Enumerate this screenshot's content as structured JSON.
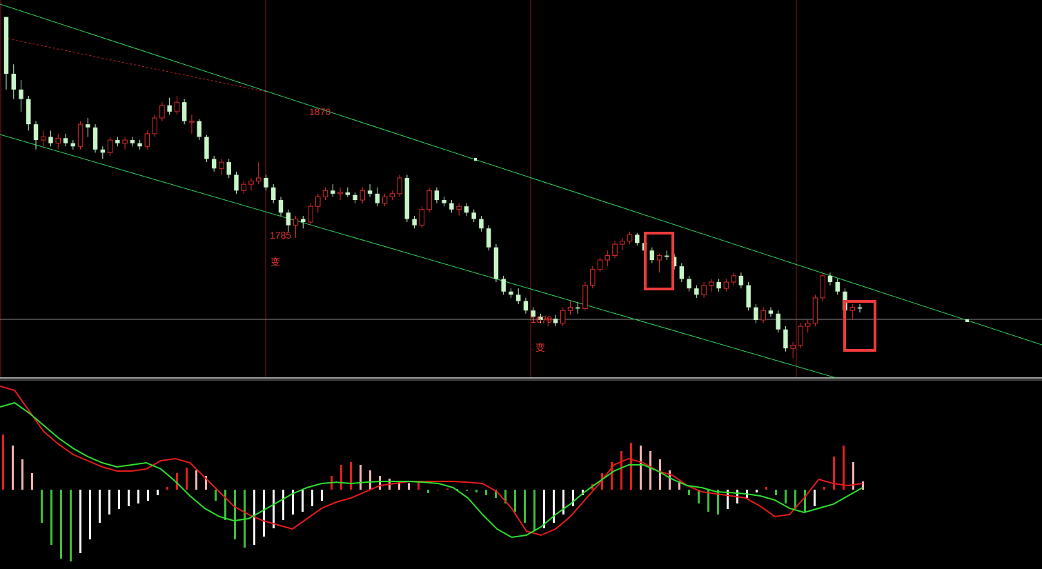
{
  "chart_data": [
    {
      "type": "candlestick",
      "title": "",
      "colors": {
        "up": "#e02b2b",
        "down": "#c8f5c8",
        "channel": "#33d65f",
        "dashed_trend": "#c62424",
        "vline": "#8a1c1c",
        "hline": "#8a8a8a",
        "highlight_box": "#ef3b3b"
      },
      "annotations": [
        {
          "label": "1870"
        },
        {
          "label": "1785"
        },
        {
          "label": "变"
        },
        {
          "label": "1679"
        },
        {
          "label": "变"
        }
      ],
      "candles_ohlc": [
        [
          1740,
          1740,
          1625,
          1650
        ],
        [
          1650,
          1665,
          1610,
          1625
        ],
        [
          1625,
          1640,
          1590,
          1610
        ],
        [
          1610,
          1615,
          1560,
          1570
        ],
        [
          1570,
          1575,
          1530,
          1545
        ],
        [
          1545,
          1560,
          1535,
          1550
        ],
        [
          1550,
          1560,
          1535,
          1540
        ],
        [
          1540,
          1555,
          1530,
          1548
        ],
        [
          1548,
          1555,
          1535,
          1540
        ],
        [
          1540,
          1545,
          1530,
          1535
        ],
        [
          1535,
          1575,
          1530,
          1570
        ],
        [
          1570,
          1580,
          1550,
          1565
        ],
        [
          1565,
          1570,
          1525,
          1530
        ],
        [
          1530,
          1535,
          1515,
          1525
        ],
        [
          1525,
          1550,
          1520,
          1545
        ],
        [
          1545,
          1550,
          1535,
          1540
        ],
        [
          1540,
          1550,
          1530,
          1545
        ],
        [
          1545,
          1550,
          1535,
          1540
        ],
        [
          1540,
          1545,
          1530,
          1535
        ],
        [
          1535,
          1560,
          1530,
          1555
        ],
        [
          1555,
          1585,
          1550,
          1580
        ],
        [
          1580,
          1605,
          1575,
          1600
        ],
        [
          1600,
          1612,
          1585,
          1590
        ],
        [
          1590,
          1615,
          1585,
          1605
        ],
        [
          1605,
          1610,
          1570,
          1575
        ],
        [
          1575,
          1585,
          1555,
          1575
        ],
        [
          1575,
          1578,
          1545,
          1550
        ],
        [
          1550,
          1553,
          1510,
          1515
        ],
        [
          1515,
          1520,
          1495,
          1500
        ],
        [
          1500,
          1515,
          1490,
          1510
        ],
        [
          1510,
          1515,
          1485,
          1490
        ],
        [
          1490,
          1495,
          1460,
          1465
        ],
        [
          1465,
          1480,
          1460,
          1475
        ],
        [
          1475,
          1485,
          1465,
          1480
        ],
        [
          1480,
          1510,
          1475,
          1485
        ],
        [
          1485,
          1490,
          1465,
          1470
        ],
        [
          1470,
          1475,
          1445,
          1450
        ],
        [
          1450,
          1455,
          1425,
          1430
        ],
        [
          1430,
          1435,
          1400,
          1410
        ],
        [
          1410,
          1425,
          1390,
          1420
        ],
        [
          1420,
          1425,
          1405,
          1415
        ],
        [
          1415,
          1445,
          1410,
          1440
        ],
        [
          1440,
          1460,
          1430,
          1455
        ],
        [
          1455,
          1470,
          1450,
          1465
        ],
        [
          1465,
          1475,
          1455,
          1460
        ],
        [
          1460,
          1470,
          1450,
          1462
        ],
        [
          1462,
          1470,
          1455,
          1458
        ],
        [
          1458,
          1462,
          1445,
          1450
        ],
        [
          1450,
          1470,
          1445,
          1465
        ],
        [
          1465,
          1475,
          1455,
          1460
        ],
        [
          1460,
          1470,
          1440,
          1445
        ],
        [
          1445,
          1460,
          1440,
          1455
        ],
        [
          1455,
          1465,
          1450,
          1460
        ],
        [
          1460,
          1490,
          1455,
          1485
        ],
        [
          1485,
          1490,
          1415,
          1420
        ],
        [
          1420,
          1425,
          1405,
          1410
        ],
        [
          1410,
          1440,
          1405,
          1435
        ],
        [
          1435,
          1470,
          1430,
          1465
        ],
        [
          1465,
          1470,
          1445,
          1450
        ],
        [
          1450,
          1455,
          1440,
          1445
        ],
        [
          1445,
          1450,
          1430,
          1435
        ],
        [
          1435,
          1445,
          1425,
          1440
        ],
        [
          1440,
          1445,
          1425,
          1430
        ],
        [
          1430,
          1435,
          1415,
          1420
        ],
        [
          1420,
          1425,
          1400,
          1405
        ],
        [
          1405,
          1410,
          1370,
          1375
        ],
        [
          1375,
          1380,
          1320,
          1325
        ],
        [
          1325,
          1330,
          1300,
          1305
        ],
        [
          1305,
          1310,
          1295,
          1300
        ],
        [
          1300,
          1310,
          1285,
          1290
        ],
        [
          1290,
          1295,
          1270,
          1275
        ],
        [
          1275,
          1280,
          1260,
          1265
        ],
        [
          1265,
          1270,
          1255,
          1260
        ],
        [
          1260,
          1265,
          1250,
          1262
        ],
        [
          1262,
          1268,
          1250,
          1255
        ],
        [
          1255,
          1280,
          1250,
          1275
        ],
        [
          1275,
          1290,
          1268,
          1280
        ],
        [
          1280,
          1288,
          1270,
          1278
        ],
        [
          1278,
          1320,
          1275,
          1315
        ],
        [
          1315,
          1345,
          1310,
          1340
        ],
        [
          1340,
          1360,
          1335,
          1355
        ],
        [
          1355,
          1370,
          1345,
          1362
        ],
        [
          1362,
          1385,
          1358,
          1380
        ],
        [
          1380,
          1390,
          1370,
          1385
        ],
        [
          1385,
          1400,
          1380,
          1395
        ],
        [
          1395,
          1398,
          1378,
          1382
        ],
        [
          1382,
          1385,
          1365,
          1370
        ],
        [
          1370,
          1375,
          1350,
          1355
        ],
        [
          1355,
          1365,
          1335,
          1362
        ],
        [
          1362,
          1370,
          1355,
          1360
        ],
        [
          1360,
          1365,
          1340,
          1345
        ],
        [
          1345,
          1350,
          1320,
          1325
        ],
        [
          1325,
          1330,
          1305,
          1310
        ],
        [
          1310,
          1315,
          1295,
          1300
        ],
        [
          1300,
          1320,
          1295,
          1315
        ],
        [
          1315,
          1325,
          1305,
          1320
        ],
        [
          1320,
          1325,
          1305,
          1310
        ],
        [
          1310,
          1325,
          1305,
          1320
        ],
        [
          1320,
          1335,
          1315,
          1330
        ],
        [
          1330,
          1335,
          1310,
          1315
        ],
        [
          1315,
          1320,
          1275,
          1280
        ],
        [
          1280,
          1285,
          1255,
          1260
        ],
        [
          1260,
          1280,
          1255,
          1275
        ],
        [
          1275,
          1280,
          1265,
          1270
        ],
        [
          1270,
          1275,
          1240,
          1245
        ],
        [
          1245,
          1250,
          1210,
          1215
        ],
        [
          1215,
          1225,
          1200,
          1220
        ],
        [
          1220,
          1255,
          1215,
          1250
        ],
        [
          1250,
          1260,
          1240,
          1255
        ],
        [
          1255,
          1300,
          1250,
          1295
        ],
        [
          1295,
          1335,
          1290,
          1330
        ],
        [
          1330,
          1335,
          1315,
          1320
        ],
        [
          1320,
          1325,
          1300,
          1305
        ],
        [
          1305,
          1310,
          1270,
          1275
        ],
        [
          1275,
          1285,
          1260,
          1280
        ],
        [
          1280,
          1285,
          1272,
          1278
        ]
      ]
    },
    {
      "type": "macd",
      "histogram": [
        1.0,
        0.8,
        0.55,
        0.3,
        -0.6,
        -1.0,
        -1.25,
        -1.3,
        -1.15,
        -0.9,
        -0.6,
        -0.45,
        -0.35,
        -0.3,
        -0.25,
        -0.2,
        -0.1,
        0.05,
        0.3,
        0.4,
        0.35,
        0.25,
        -0.2,
        -0.55,
        -0.9,
        -1.05,
        -1.0,
        -0.85,
        -0.7,
        -0.55,
        -0.45,
        -0.4,
        -0.3,
        -0.2,
        0.25,
        0.45,
        0.5,
        0.45,
        0.35,
        0.25,
        0.2,
        0.15,
        0.12,
        0.15,
        -0.06,
        0.0,
        0.02,
        0.01,
        -0.02,
        -0.05,
        -0.1,
        -0.15,
        -0.25,
        -0.4,
        -0.6,
        -0.75,
        -0.7,
        -0.6,
        -0.45,
        -0.3,
        -0.1,
        0.1,
        0.3,
        0.5,
        0.7,
        0.85,
        0.8,
        0.7,
        0.55,
        0.35,
        0.15,
        -0.1,
        -0.25,
        -0.4,
        -0.45,
        -0.35,
        -0.25,
        -0.15,
        -0.05,
        0.05,
        -0.1,
        -0.25,
        -0.35,
        -0.4,
        -0.3,
        0.05,
        0.6,
        0.8,
        0.5,
        0.15
      ],
      "dif": [
        2.0,
        1.9,
        1.4,
        0.9,
        0.6,
        0.35,
        0.2,
        0.05,
        -0.05,
        -0.05,
        0.0,
        0.2,
        0.25,
        0.15,
        -0.2,
        -0.55,
        -0.9,
        -1.1,
        -1.25,
        -1.35,
        -1.45,
        -1.2,
        -0.95,
        -0.8,
        -0.7,
        -0.55,
        -0.4,
        -0.35,
        -0.3,
        -0.3,
        -0.3,
        -0.3,
        -0.32,
        -0.35,
        -0.55,
        -0.95,
        -1.5,
        -1.6,
        -1.45,
        -1.15,
        -0.75,
        -0.35,
        0.1,
        0.25,
        0.15,
        -0.05,
        -0.15,
        -0.4,
        -0.55,
        -0.6,
        -0.65,
        -0.7,
        -0.9,
        -1.15,
        -1.1,
        -0.7,
        -0.25,
        -0.35,
        -0.4,
        -0.35
      ],
      "dea": [
        1.5,
        1.6,
        1.35,
        1.05,
        0.75,
        0.5,
        0.3,
        0.15,
        0.05,
        0.1,
        0.15,
        0.0,
        -0.3,
        -0.65,
        -0.95,
        -1.15,
        -1.25,
        -1.2,
        -1.0,
        -0.8,
        -0.6,
        -0.45,
        -0.35,
        -0.32,
        -0.35,
        -0.32,
        -0.3,
        -0.3,
        -0.3,
        -0.32,
        -0.35,
        -0.45,
        -0.7,
        -1.1,
        -1.45,
        -1.65,
        -1.6,
        -1.4,
        -1.1,
        -0.85,
        -0.55,
        -0.3,
        -0.05,
        0.1,
        0.1,
        -0.05,
        -0.25,
        -0.4,
        -0.45,
        -0.55,
        -0.57,
        -0.6,
        -0.65,
        -0.75,
        -0.95,
        -1.05,
        -0.95,
        -0.85,
        -0.65,
        -0.45
      ]
    }
  ]
}
